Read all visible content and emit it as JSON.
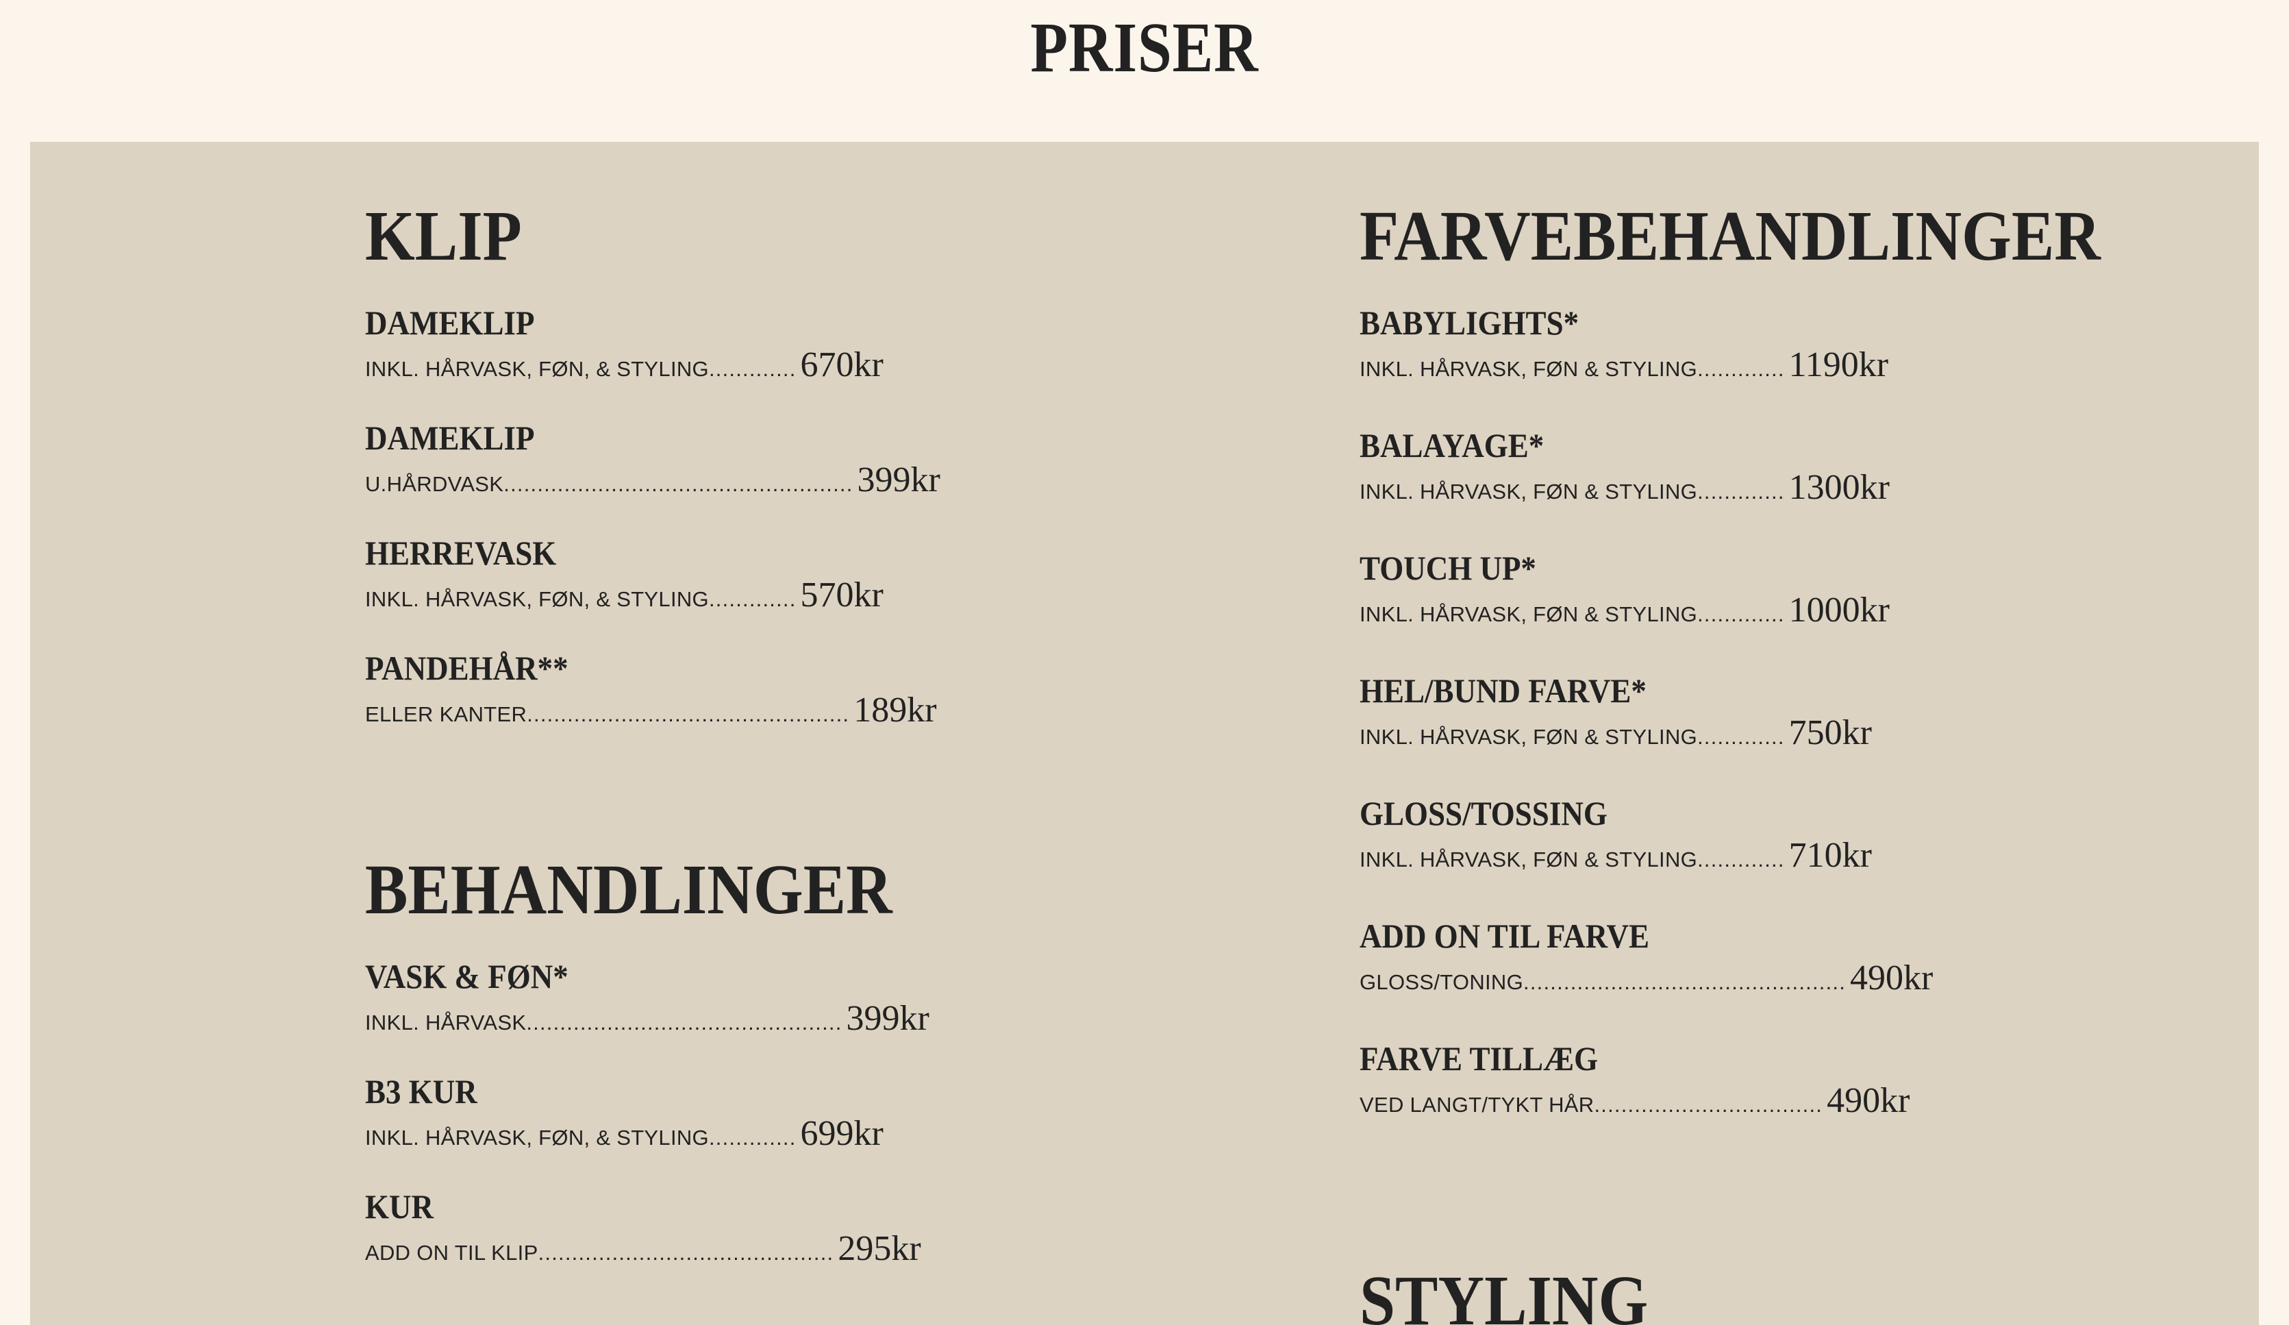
{
  "page": {
    "title": "PRISER"
  },
  "sections": {
    "klip": {
      "title": "KLIP",
      "items": [
        {
          "name": "DAMEKLIP",
          "desc": "INKL. HÅRVASK, FØN, & STYLING",
          "dots": ".............",
          "price": "670kr"
        },
        {
          "name": "DAMEKLIP",
          "desc": "U.HÅRDVASK",
          "dots": "....................................................",
          "price": "399kr"
        },
        {
          "name": "HERREVASK",
          "desc": "INKL. HÅRVASK, FØN, & STYLING",
          "dots": ".............",
          "price": "570kr"
        },
        {
          "name": "PANDEHÅR**",
          "desc": "ELLER KANTER",
          "dots": "................................................",
          "price": "189kr"
        }
      ]
    },
    "behandlinger": {
      "title": "BEHANDLINGER",
      "items": [
        {
          "name": "VASK & FØN*",
          "desc": "INKL. HÅRVASK",
          "dots": "...............................................",
          "price": "399kr"
        },
        {
          "name": "B3 KUR",
          "desc": "INKL. HÅRVASK, FØN, & STYLING",
          "dots": ".............",
          "price": "699kr"
        },
        {
          "name": "KUR",
          "desc": "ADD ON TIL KLIP",
          "dots": "............................................",
          "price": "295kr"
        }
      ]
    },
    "farvebehandlinger": {
      "title": "FARVEBEHANDLINGER",
      "items": [
        {
          "name": "BABYLIGHTS*",
          "desc": "INKL. HÅRVASK, FØN & STYLING",
          "dots": ".............",
          "price": "1190kr"
        },
        {
          "name": "BALAYAGE*",
          "desc": "INKL. HÅRVASK, FØN & STYLING",
          "dots": ".............",
          "price": "1300kr"
        },
        {
          "name": "TOUCH UP*",
          "desc": "INKL. HÅRVASK, FØN & STYLING",
          "dots": ".............",
          "price": "1000kr"
        },
        {
          "name": "HEL/BUND FARVE*",
          "desc": "INKL. HÅRVASK, FØN & STYLING",
          "dots": ".............",
          "price": "750kr"
        },
        {
          "name": "GLOSS/TOSSING",
          "desc": "INKL. HÅRVASK, FØN & STYLING",
          "dots": ".............",
          "price": "710kr"
        },
        {
          "name": "ADD ON TIL FARVE",
          "desc": "GLOSS/TONING",
          "dots": "................................................",
          "price": "490kr"
        },
        {
          "name": "FARVE TILLÆG",
          "desc": "VED LANGT/TYKT HÅR",
          "dots": "..................................",
          "price": "490kr"
        }
      ]
    },
    "styling": {
      "title": "STYLING"
    }
  },
  "colors": {
    "page_background": "#fcf5ec",
    "panel_background": "#ddd3c2",
    "text": "#222222"
  }
}
